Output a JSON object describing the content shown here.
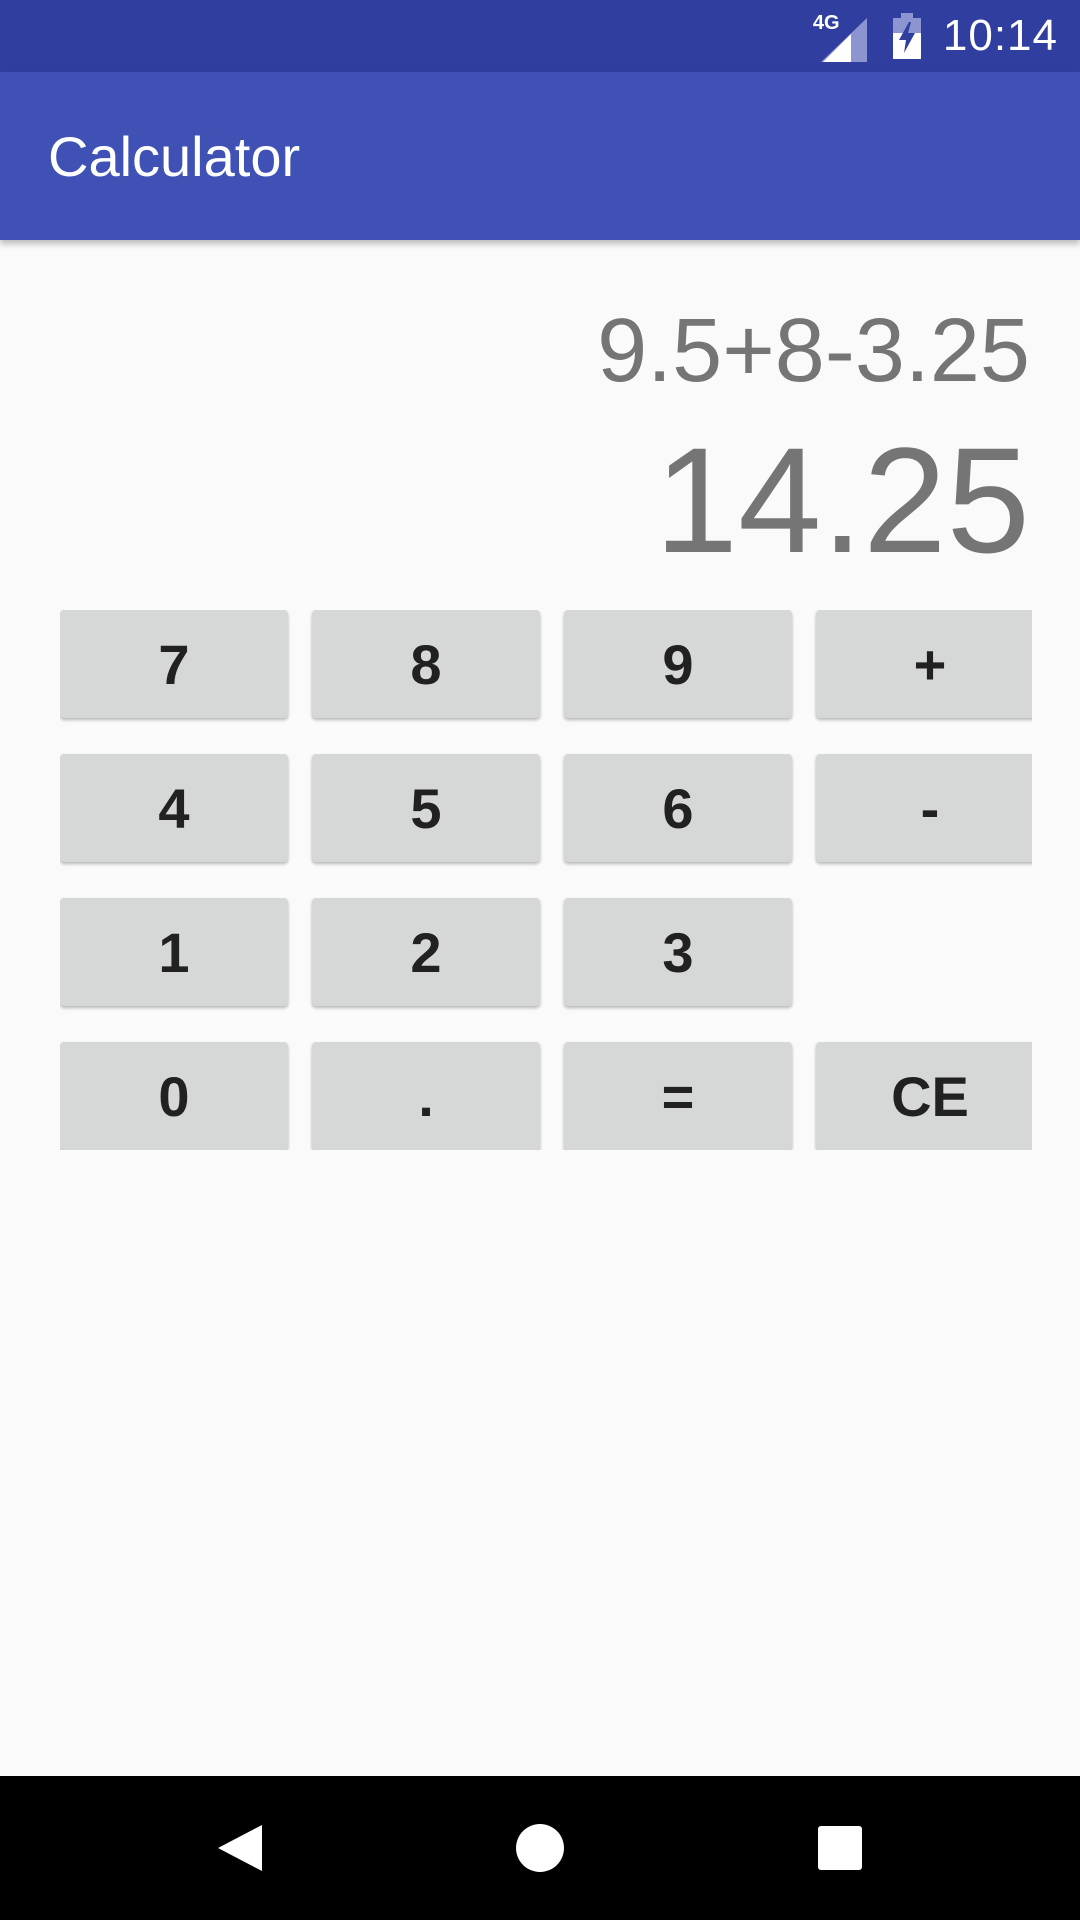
{
  "status_bar": {
    "network": "4G",
    "time": "10:14",
    "icons": [
      "signal-icon",
      "battery-charging-icon"
    ]
  },
  "app_bar": {
    "title": "Calculator"
  },
  "display": {
    "expression": "9.5+8-3.25",
    "result": "14.25"
  },
  "keypad": {
    "keys": [
      "7",
      "8",
      "9",
      "+",
      "4",
      "5",
      "6",
      "-",
      "1",
      "2",
      "3",
      "0",
      ".",
      "=",
      "CE"
    ]
  },
  "navigation": {
    "icons": [
      "back-icon",
      "home-icon",
      "recents-icon"
    ]
  },
  "colors": {
    "status_bar": "#303f9f",
    "app_bar": "#3f51b5",
    "background": "#fafafa",
    "key": "#d6d7d7",
    "display_text": "#757575"
  }
}
